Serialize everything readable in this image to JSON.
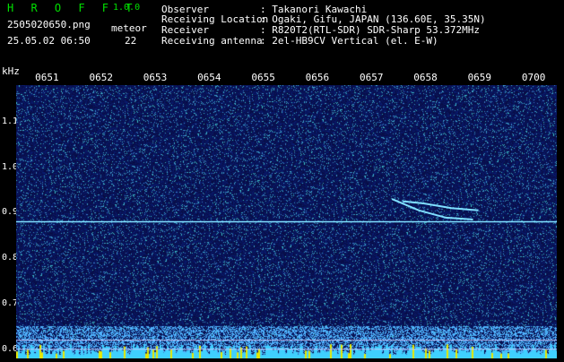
{
  "app": {
    "name": "H R O F F T",
    "version": "1.0.0"
  },
  "file": {
    "name": "2505020650.png",
    "datetime": "25.05.02 06:50"
  },
  "meteor": {
    "label": "meteor",
    "count": "22"
  },
  "info": [
    {
      "label": "Observer",
      "value": ": Takanori Kawachi"
    },
    {
      "label": "Receiving Location",
      "value": ": Ogaki, Gifu, JAPAN (136.60E, 35.35N)"
    },
    {
      "label": "Receiver",
      "value": ": R820T2(RTL-SDR) SDR-Sharp 53.372MHz"
    },
    {
      "label": "Receiving antenna",
      "value": ": 2el-HB9CV Vertical (el. E-W)"
    }
  ],
  "colors": {
    "background": "#000000",
    "spectrum_base": "#0a0a60",
    "trace": "#7fdfff",
    "header_title": "#00e000",
    "text": "#ffffff"
  },
  "chart_data": {
    "type": "heatmap",
    "xlabel": "",
    "ylabel": "kHz",
    "x_ticks": [
      "0651",
      "0652",
      "0653",
      "0654",
      "0655",
      "0656",
      "0657",
      "0658",
      "0659",
      "0700"
    ],
    "y_ticks": [
      "1.1",
      "1.0",
      "0.9",
      "0.8",
      "0.7",
      "0.6"
    ],
    "ylim": [
      0.58,
      1.18
    ],
    "carrier_khz": 0.88,
    "meteor_traces": [
      {
        "name": "",
        "points": [
          [
            6.6,
            0.925
          ],
          [
            7.0,
            0.92
          ],
          [
            7.5,
            0.91
          ],
          [
            8.0,
            0.905
          ]
        ]
      },
      {
        "name": "",
        "points": [
          [
            6.4,
            0.93
          ],
          [
            6.9,
            0.905
          ],
          [
            7.4,
            0.889
          ],
          [
            7.9,
            0.885
          ]
        ]
      }
    ]
  }
}
